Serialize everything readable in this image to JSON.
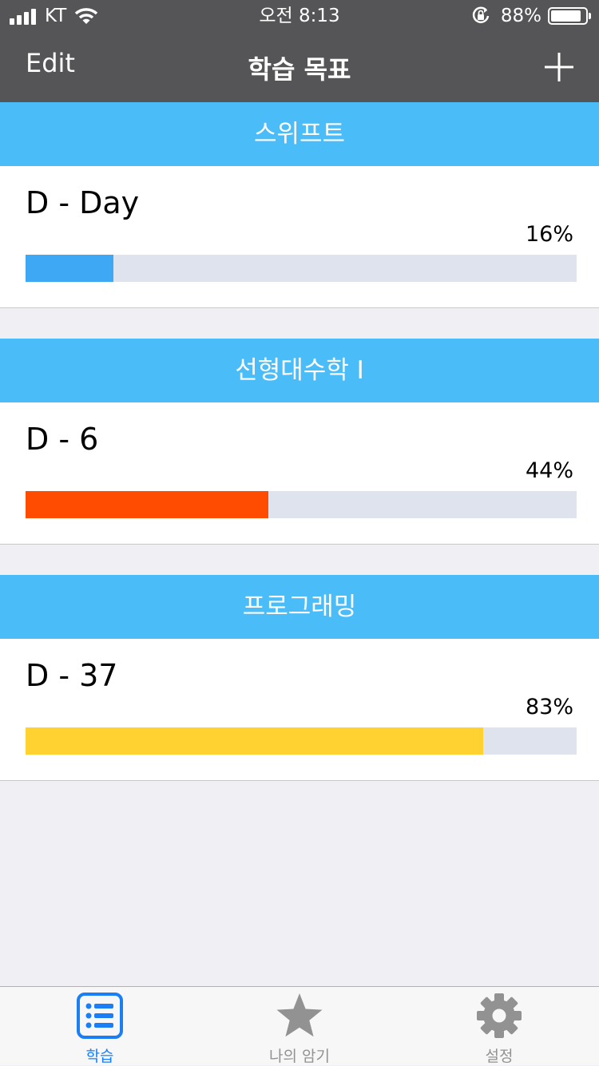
{
  "status_bar": {
    "carrier": "KT",
    "time": "오전 8:13",
    "battery_text": "88%",
    "battery_level": 0.88
  },
  "nav": {
    "edit_label": "Edit",
    "title": "학습 목표",
    "add_icon": "plus-icon"
  },
  "goals": [
    {
      "subject": "스위프트",
      "dday": "D - Day",
      "percent_label": "16%",
      "progress": 0.16,
      "color": "#3fa8f4"
    },
    {
      "subject": "선형대수학 I",
      "dday": "D - 6",
      "percent_label": "44%",
      "progress": 0.44,
      "color": "#ff4c00"
    },
    {
      "subject": "프로그래밍",
      "dday": "D - 37",
      "percent_label": "83%",
      "progress": 0.83,
      "color": "#ffd232"
    }
  ],
  "tabbar": {
    "tabs": [
      {
        "label": "학습",
        "icon": "list-icon",
        "active": true
      },
      {
        "label": "나의 암기",
        "icon": "star-icon",
        "active": false
      },
      {
        "label": "설정",
        "icon": "gear-icon",
        "active": false
      }
    ],
    "active_color": "#1a7ef5",
    "inactive_color": "#929292"
  }
}
